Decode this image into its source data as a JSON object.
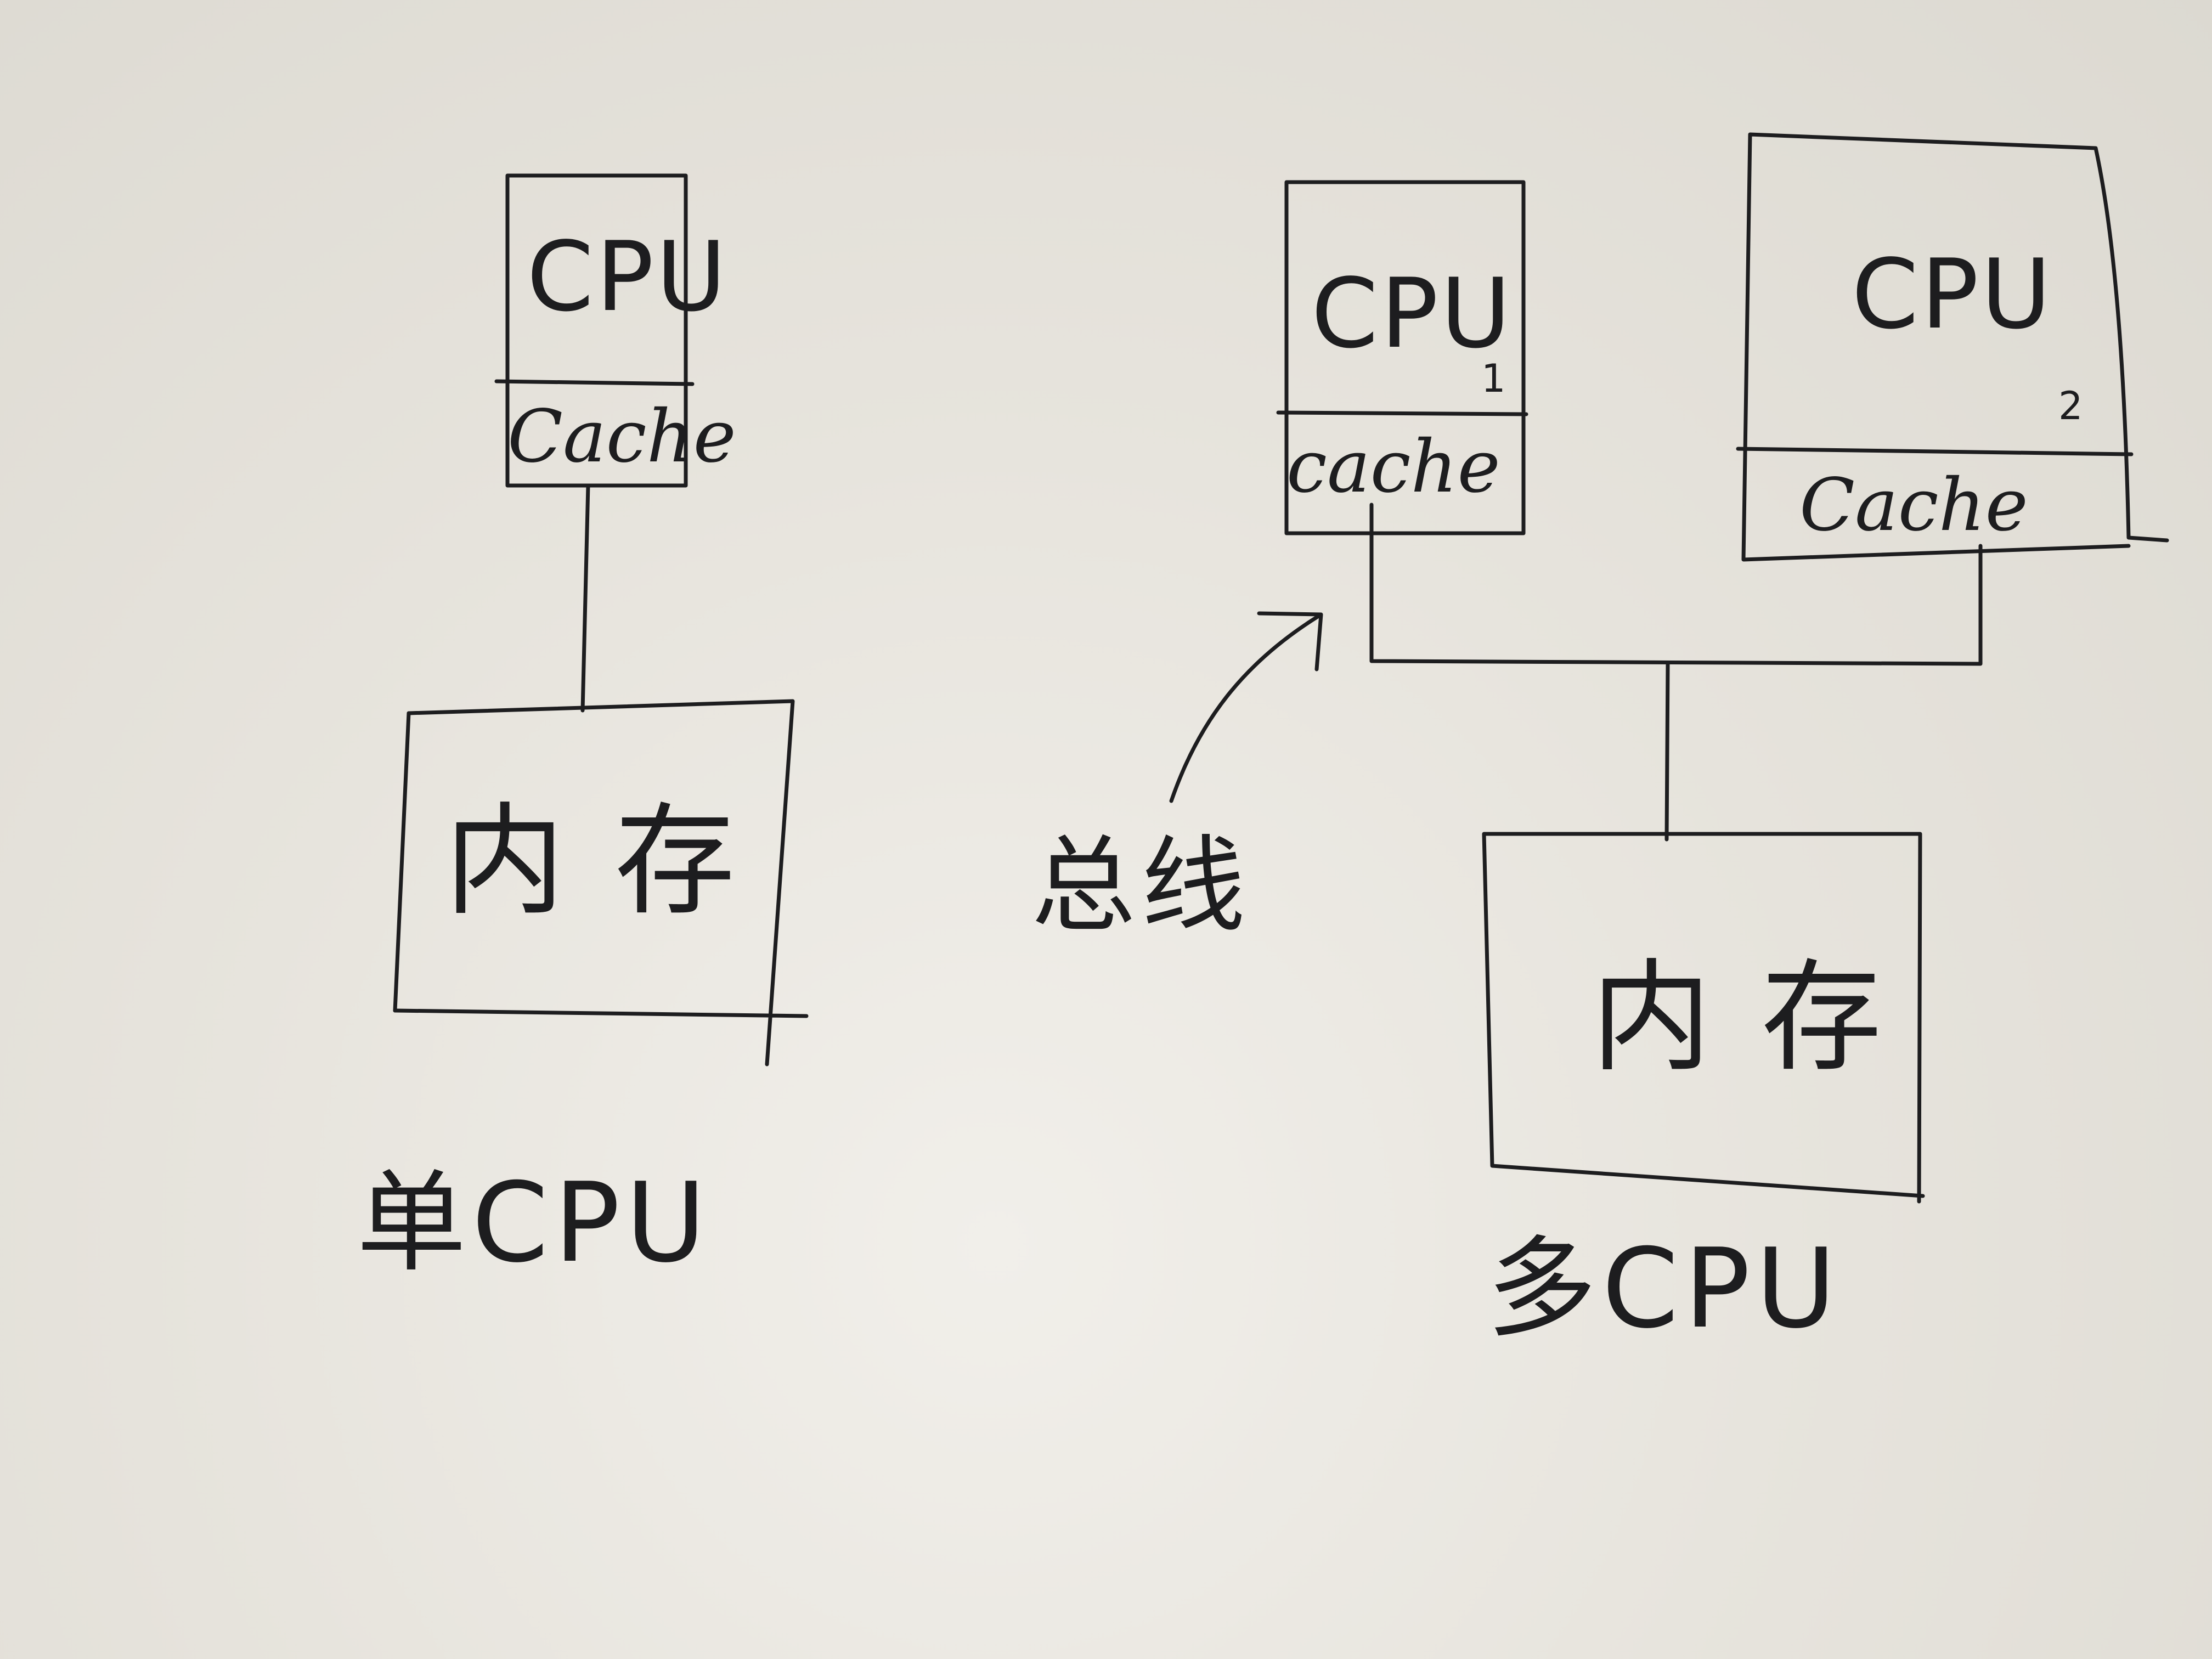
{
  "single": {
    "cpu": "CPU",
    "cache": "Cache",
    "memory": "内存",
    "caption": "单CPU"
  },
  "multi": {
    "cpu1": {
      "label": "CPU",
      "sub": "1",
      "cache": "cache"
    },
    "cpu2": {
      "label": "CPU",
      "sub": "2",
      "cache": "Cache"
    },
    "memory": "内存",
    "bus": "总线",
    "caption": "多CPU"
  }
}
